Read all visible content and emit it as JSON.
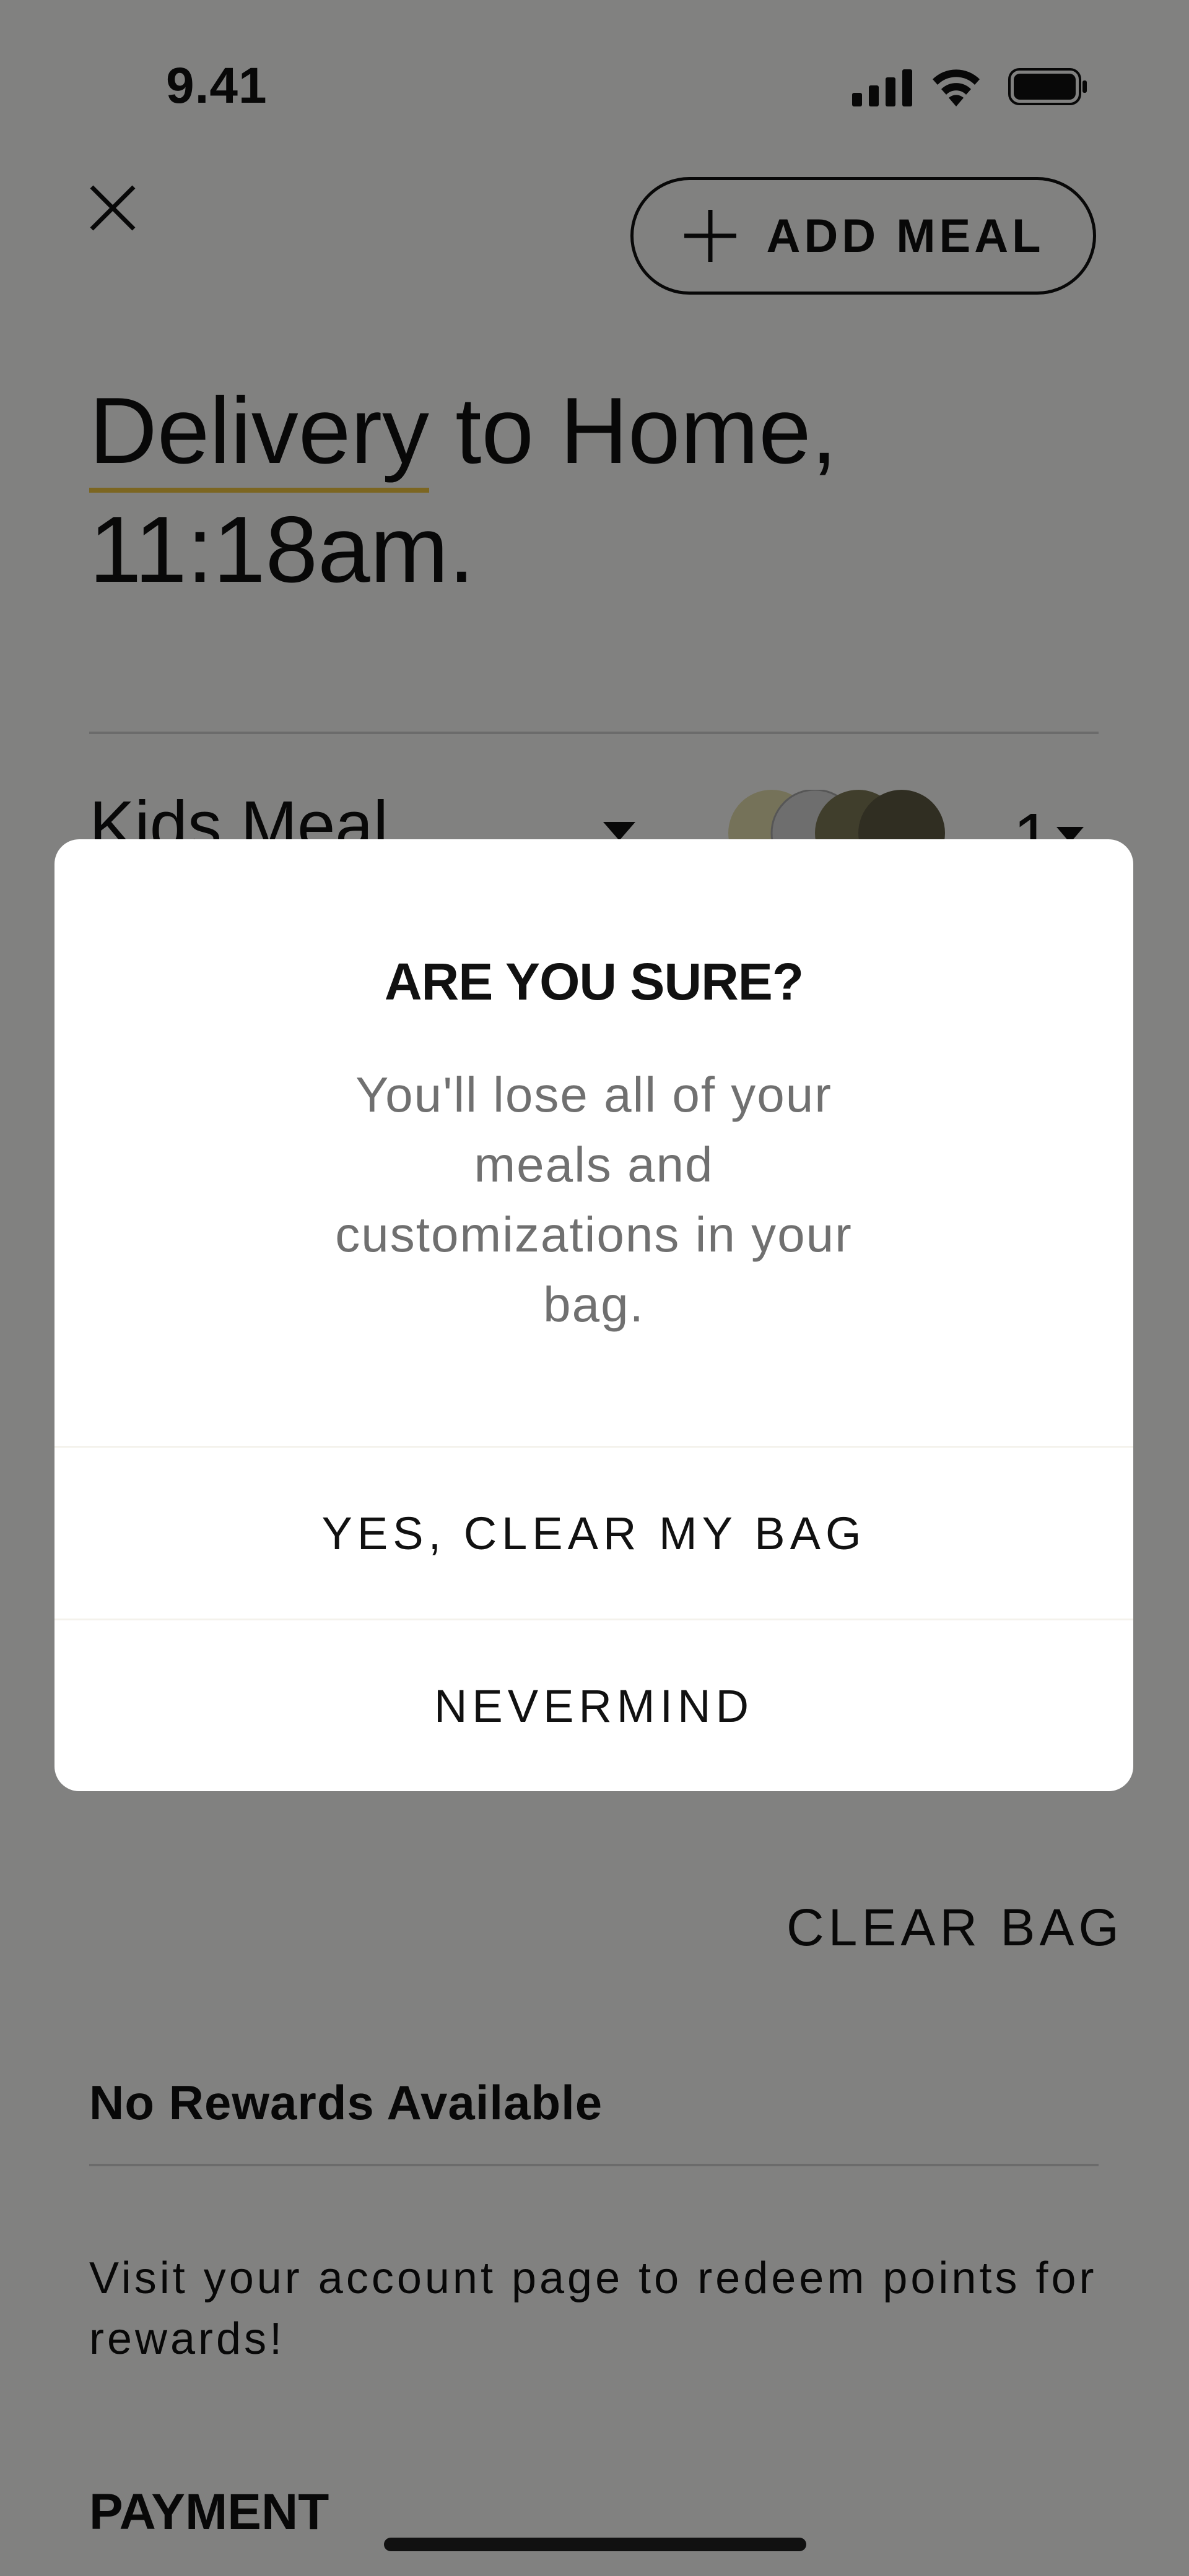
{
  "status_bar": {
    "time": "9.41"
  },
  "header": {
    "add_meal_label": "ADD MEAL"
  },
  "order": {
    "heading_highlight": "Delivery",
    "heading_rest": " to Home,",
    "heading_line2": "11:18am."
  },
  "meal": {
    "name": "Kids Meal",
    "quantity": "1"
  },
  "actions": {
    "clear_bag_label": "CLEAR BAG"
  },
  "rewards": {
    "title": "No Rewards Available",
    "description": "Visit your account page to redeem points for rewards!"
  },
  "payment": {
    "title": "PAYMENT"
  },
  "modal": {
    "title": "ARE YOU SURE?",
    "body": "You'll lose all of your meals and customizations in your bag.",
    "confirm_label": "YES, CLEAR MY BAG",
    "cancel_label": "NEVERMIND"
  },
  "colors": {
    "accent_underline": "#f4c842",
    "overlay": "rgba(0,0,0,0.49)"
  },
  "icons": [
    "close-icon",
    "plus-icon",
    "chevron-down-icon",
    "signal-icon",
    "wifi-icon",
    "battery-icon"
  ]
}
